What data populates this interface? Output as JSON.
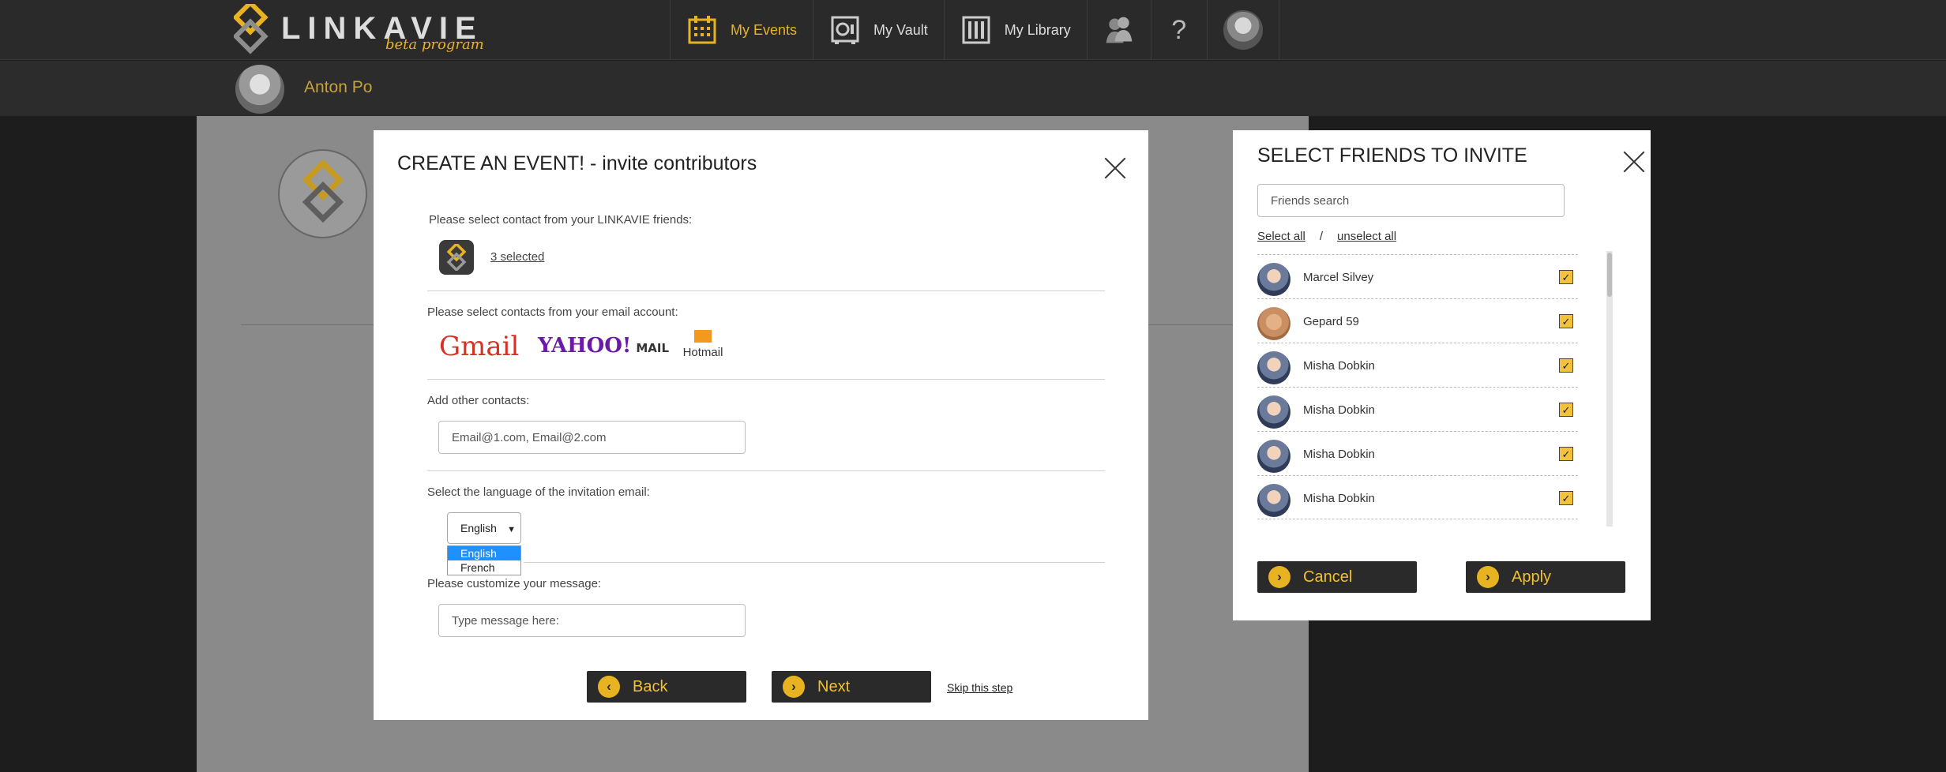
{
  "header": {
    "logo_text": "LINKAVIE",
    "logo_sub": "beta program",
    "nav": [
      {
        "label": "My Events"
      },
      {
        "label": "My Vault"
      },
      {
        "label": "My Library"
      }
    ],
    "help": "?"
  },
  "subheader": {
    "user_name": "Anton Po"
  },
  "create_event_modal": {
    "title": "CREATE AN EVENT! - invite contributors",
    "friends_label": "Please select contact from your LINKAVIE friends:",
    "selected_link": "3 selected",
    "email_label": "Please select contacts from your email account:",
    "providers": {
      "gmail": "Gmail",
      "yahoo": "YAHOO!",
      "yahoo_mail": "MAIL",
      "hotmail": "Hotmail"
    },
    "other_label": "Add other contacts:",
    "other_placeholder": "Email@1.com, Email@2.com",
    "language_label": "Select the language of the invitation email:",
    "language_selected": "English",
    "language_options": [
      "English",
      "French"
    ],
    "message_label": "Please customize your message:",
    "message_placeholder": "Type message here:",
    "back_label": "Back",
    "next_label": "Next",
    "skip_label": "Skip this step"
  },
  "friends_modal": {
    "title": "SELECT FRIENDS TO INVITE",
    "search_placeholder": "Friends search",
    "select_all": "Select all",
    "separator": "/",
    "unselect_all": "unselect all",
    "friends": [
      {
        "name": "Marcel Silvey",
        "checked": true
      },
      {
        "name": "Gepard 59",
        "checked": true
      },
      {
        "name": "Misha Dobkin",
        "checked": true
      },
      {
        "name": "Misha Dobkin",
        "checked": true
      },
      {
        "name": "Misha Dobkin",
        "checked": true
      },
      {
        "name": "Misha Dobkin",
        "checked": true
      }
    ],
    "cancel_label": "Cancel",
    "apply_label": "Apply"
  },
  "colors": {
    "accent": "#e8b320",
    "dark": "#2a2a2a",
    "page": "#8a8a8a"
  }
}
